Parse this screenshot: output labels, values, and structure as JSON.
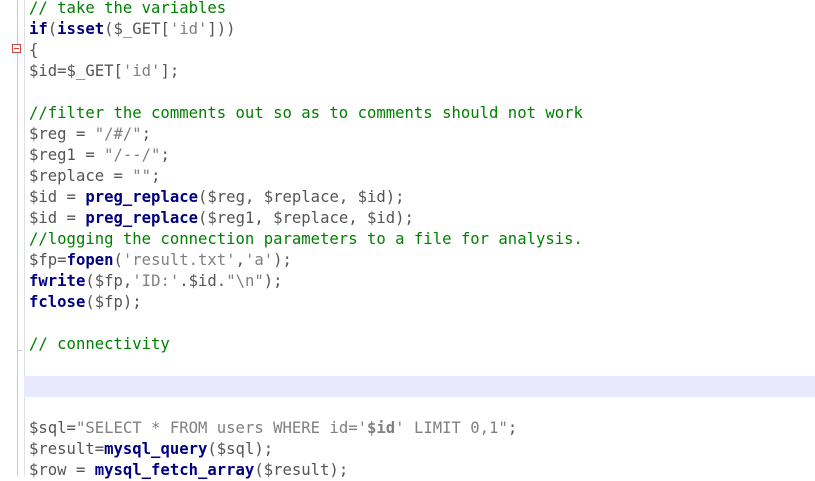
{
  "editor": {
    "lines": [
      [
        {
          "t": "// take the variables",
          "c": "comment"
        }
      ],
      [
        {
          "t": "if",
          "c": "keyword"
        },
        {
          "t": "(",
          "c": "op"
        },
        {
          "t": "isset",
          "c": "keyword"
        },
        {
          "t": "($_GET[",
          "c": "op"
        },
        {
          "t": "'id'",
          "c": "string"
        },
        {
          "t": "]))",
          "c": "op"
        }
      ],
      [
        {
          "t": "{",
          "c": "op"
        }
      ],
      [
        {
          "t": "$id=$_GET[",
          "c": "var"
        },
        {
          "t": "'id'",
          "c": "string"
        },
        {
          "t": "];",
          "c": "op"
        }
      ],
      [],
      [
        {
          "t": "//filter the comments out so as to comments should not work",
          "c": "comment"
        }
      ],
      [
        {
          "t": "$reg = ",
          "c": "var"
        },
        {
          "t": "\"/#/\"",
          "c": "string"
        },
        {
          "t": ";",
          "c": "op"
        }
      ],
      [
        {
          "t": "$reg1 = ",
          "c": "var"
        },
        {
          "t": "\"/--/\"",
          "c": "string"
        },
        {
          "t": ";",
          "c": "op"
        }
      ],
      [
        {
          "t": "$replace = ",
          "c": "var"
        },
        {
          "t": "\"\"",
          "c": "string"
        },
        {
          "t": ";",
          "c": "op"
        }
      ],
      [
        {
          "t": "$id = ",
          "c": "var"
        },
        {
          "t": "preg_replace",
          "c": "func"
        },
        {
          "t": "($reg, $replace, $id);",
          "c": "op"
        }
      ],
      [
        {
          "t": "$id = ",
          "c": "var"
        },
        {
          "t": "preg_replace",
          "c": "func"
        },
        {
          "t": "($reg1, $replace, $id);",
          "c": "op"
        }
      ],
      [
        {
          "t": "//logging the connection parameters to a file for analysis.",
          "c": "comment"
        }
      ],
      [
        {
          "t": "$fp=",
          "c": "var"
        },
        {
          "t": "fopen",
          "c": "func"
        },
        {
          "t": "(",
          "c": "op"
        },
        {
          "t": "'result.txt'",
          "c": "string"
        },
        {
          "t": ",",
          "c": "op"
        },
        {
          "t": "'a'",
          "c": "string"
        },
        {
          "t": ");",
          "c": "op"
        }
      ],
      [
        {
          "t": "fwrite",
          "c": "func"
        },
        {
          "t": "($fp,",
          "c": "op"
        },
        {
          "t": "'ID:'",
          "c": "string"
        },
        {
          "t": ".$id.",
          "c": "op"
        },
        {
          "t": "\"\\n\"",
          "c": "string"
        },
        {
          "t": ");",
          "c": "op"
        }
      ],
      [
        {
          "t": "fclose",
          "c": "func"
        },
        {
          "t": "($fp);",
          "c": "op"
        }
      ],
      [],
      [
        {
          "t": "// connectivity",
          "c": "comment"
        }
      ],
      [],
      [],
      [],
      [
        {
          "t": "$sql=",
          "c": "var"
        },
        {
          "t": "\"SELECT * FROM users WHERE id='",
          "c": "string"
        },
        {
          "t": "$id",
          "c": "strvar"
        },
        {
          "t": "' LIMIT 0,1\"",
          "c": "string"
        },
        {
          "t": ";",
          "c": "op"
        }
      ],
      [
        {
          "t": "$result=",
          "c": "var"
        },
        {
          "t": "mysql_query",
          "c": "func"
        },
        {
          "t": "($sql);",
          "c": "op"
        }
      ],
      [
        {
          "t": "$row = ",
          "c": "var"
        },
        {
          "t": "mysql_fetch_array",
          "c": "func"
        },
        {
          "t": "($result);",
          "c": "op"
        }
      ]
    ],
    "current_line": 18,
    "fold_icon": "fold-collapse-icon"
  }
}
